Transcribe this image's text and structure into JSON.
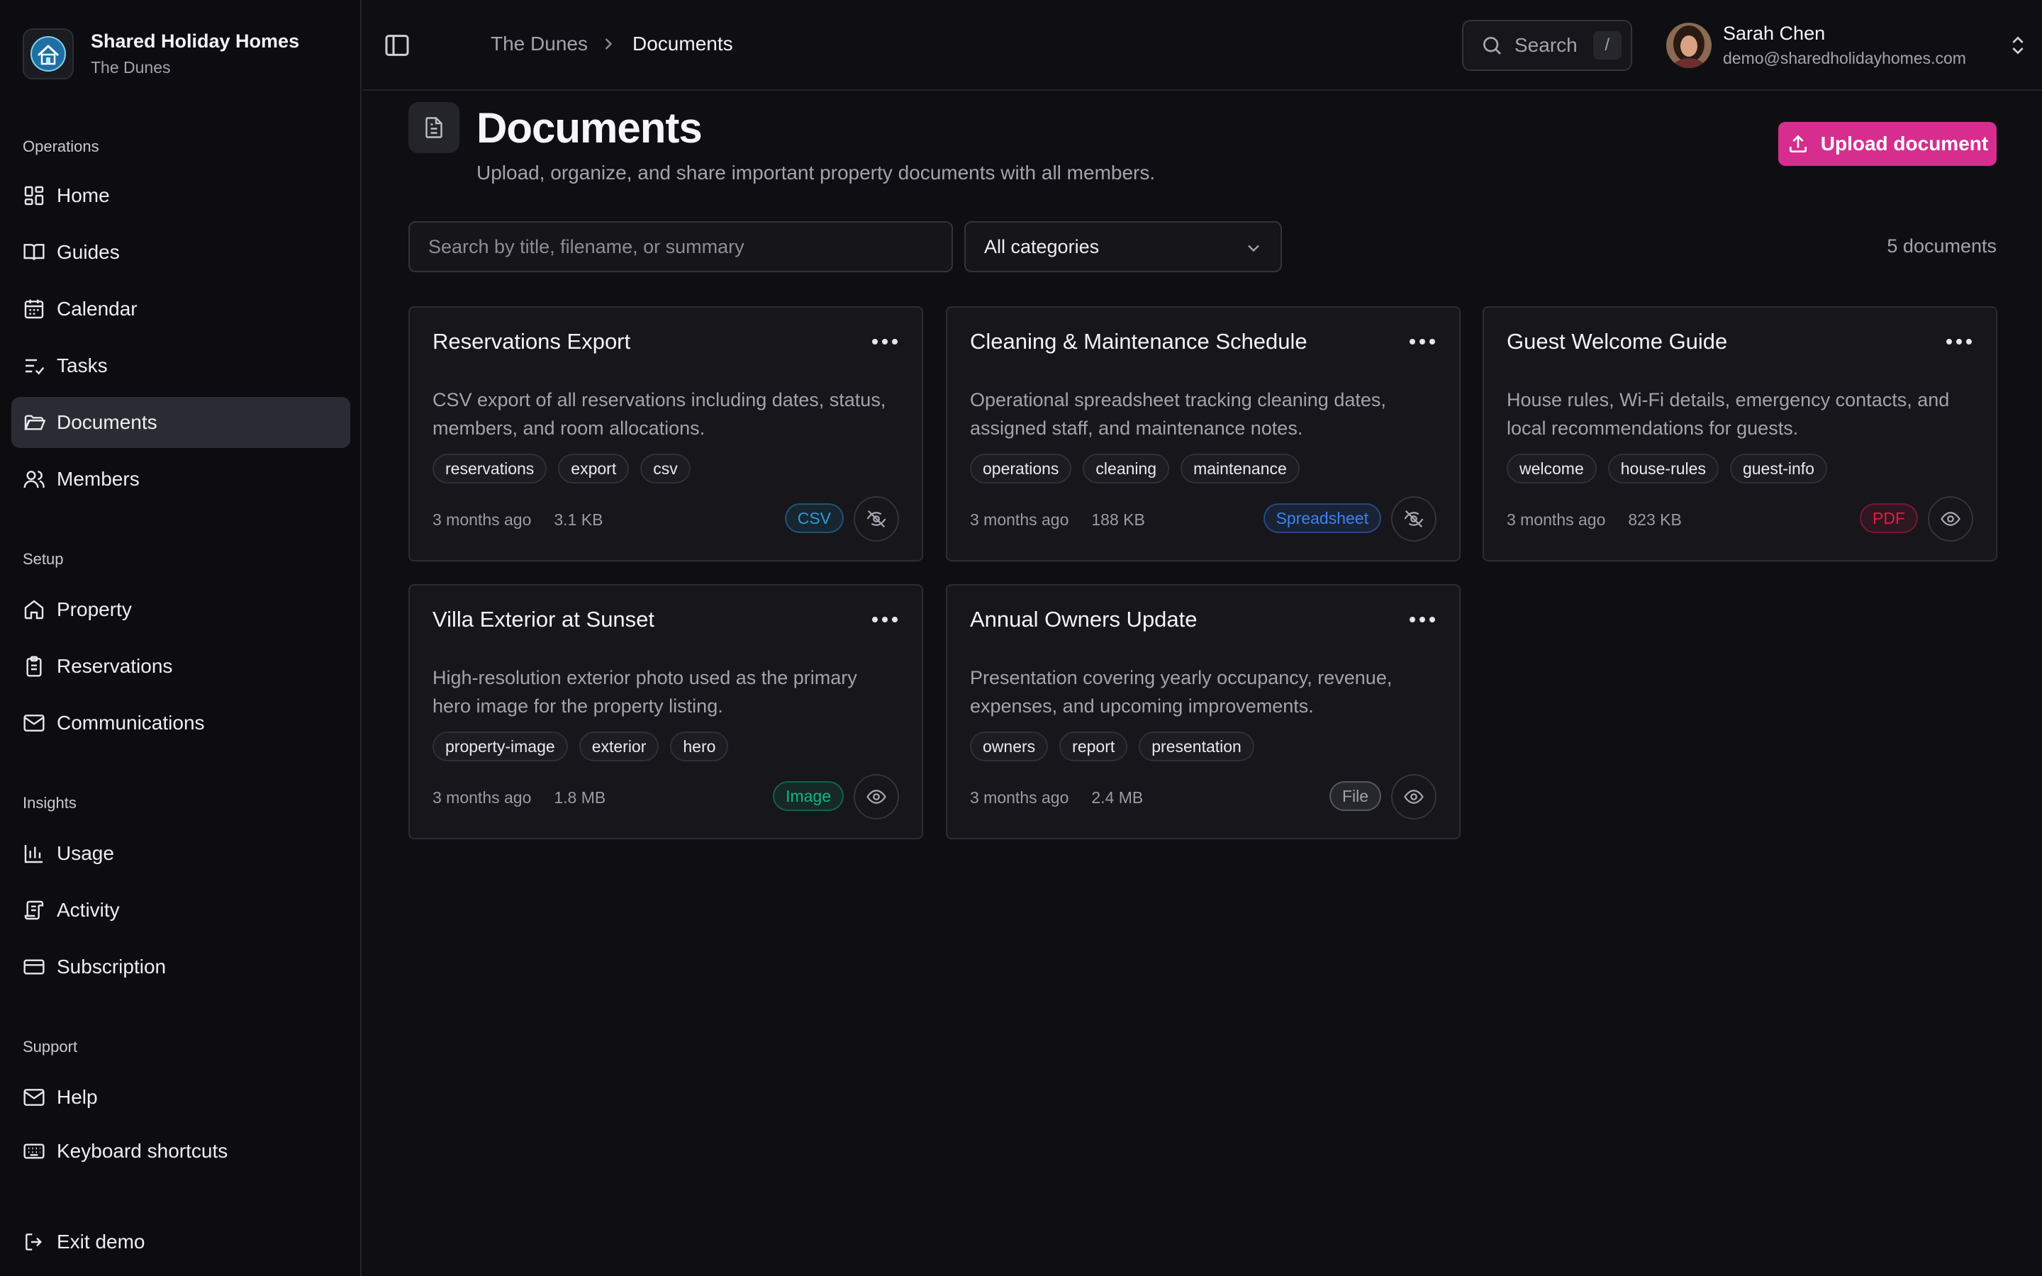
{
  "workspace": {
    "name": "Shared Holiday Homes",
    "property": "The Dunes"
  },
  "sidebar": {
    "sections": [
      {
        "label": "Operations",
        "items": [
          {
            "label": "Home",
            "icon": "dashboard-icon"
          },
          {
            "label": "Guides",
            "icon": "book-icon"
          },
          {
            "label": "Calendar",
            "icon": "calendar-icon"
          },
          {
            "label": "Tasks",
            "icon": "checklist-icon"
          },
          {
            "label": "Documents",
            "icon": "folder-icon",
            "active": true
          },
          {
            "label": "Members",
            "icon": "users-icon"
          }
        ]
      },
      {
        "label": "Setup",
        "items": [
          {
            "label": "Property",
            "icon": "house-icon"
          },
          {
            "label": "Reservations",
            "icon": "clipboard-icon"
          },
          {
            "label": "Communications",
            "icon": "mail-icon"
          }
        ]
      },
      {
        "label": "Insights",
        "items": [
          {
            "label": "Usage",
            "icon": "bar-chart-icon"
          },
          {
            "label": "Activity",
            "icon": "scroll-icon"
          },
          {
            "label": "Subscription",
            "icon": "credit-card-icon"
          }
        ]
      },
      {
        "label": "Support",
        "items": [
          {
            "label": "Help",
            "icon": "mail-icon"
          },
          {
            "label": "Keyboard shortcuts",
            "icon": "keyboard-icon"
          }
        ]
      }
    ],
    "exit": {
      "label": "Exit demo",
      "icon": "logout-icon"
    }
  },
  "breadcrumb": [
    "The Dunes",
    "Documents"
  ],
  "search": {
    "label": "Search",
    "shortcut": "/"
  },
  "user": {
    "name": "Sarah Chen",
    "email": "demo@sharedholidayhomes.com"
  },
  "page": {
    "title": "Documents",
    "subtitle": "Upload, organize, and share important property documents with all members.",
    "upload_label": "Upload document"
  },
  "filters": {
    "search_placeholder": "Search by title, filename, or summary",
    "category_selected": "All categories",
    "count_label": "5 documents"
  },
  "colors": {
    "accent": "#d62d8e",
    "badge_csv": "#2b9bd8",
    "badge_spreadsheet": "#3b82f6",
    "badge_pdf": "#e11d48",
    "badge_image": "#10b981",
    "badge_file": "#9ca3af"
  },
  "documents": [
    {
      "title": "Reservations Export",
      "summary": "CSV export of all reservations including dates, status, members, and room allocations.",
      "tags": [
        "reservations",
        "export",
        "csv"
      ],
      "age": "3 months ago",
      "size": "3.1 KB",
      "type": "CSV",
      "type_color": "#2b9bd8",
      "visible": false
    },
    {
      "title": "Cleaning & Maintenance Schedule",
      "summary": "Operational spreadsheet tracking cleaning dates, assigned staff, and maintenance notes.",
      "tags": [
        "operations",
        "cleaning",
        "maintenance"
      ],
      "age": "3 months ago",
      "size": "188 KB",
      "type": "Spreadsheet",
      "type_color": "#3b82f6",
      "visible": false
    },
    {
      "title": "Guest Welcome Guide",
      "summary": "House rules, Wi-Fi details, emergency contacts, and local recommendations for guests.",
      "tags": [
        "welcome",
        "house-rules",
        "guest-info"
      ],
      "age": "3 months ago",
      "size": "823 KB",
      "type": "PDF",
      "type_color": "#e11d48",
      "visible": true
    },
    {
      "title": "Villa Exterior at Sunset",
      "summary": "High-resolution exterior photo used as the primary hero image for the property listing.",
      "tags": [
        "property-image",
        "exterior",
        "hero"
      ],
      "age": "3 months ago",
      "size": "1.8 MB",
      "type": "Image",
      "type_color": "#10b981",
      "visible": true
    },
    {
      "title": "Annual Owners Update",
      "summary": "Presentation covering yearly occupancy, revenue, expenses, and upcoming improvements.",
      "tags": [
        "owners",
        "report",
        "presentation"
      ],
      "age": "3 months ago",
      "size": "2.4 MB",
      "type": "File",
      "type_color": "#9ca3af",
      "visible": true
    }
  ]
}
